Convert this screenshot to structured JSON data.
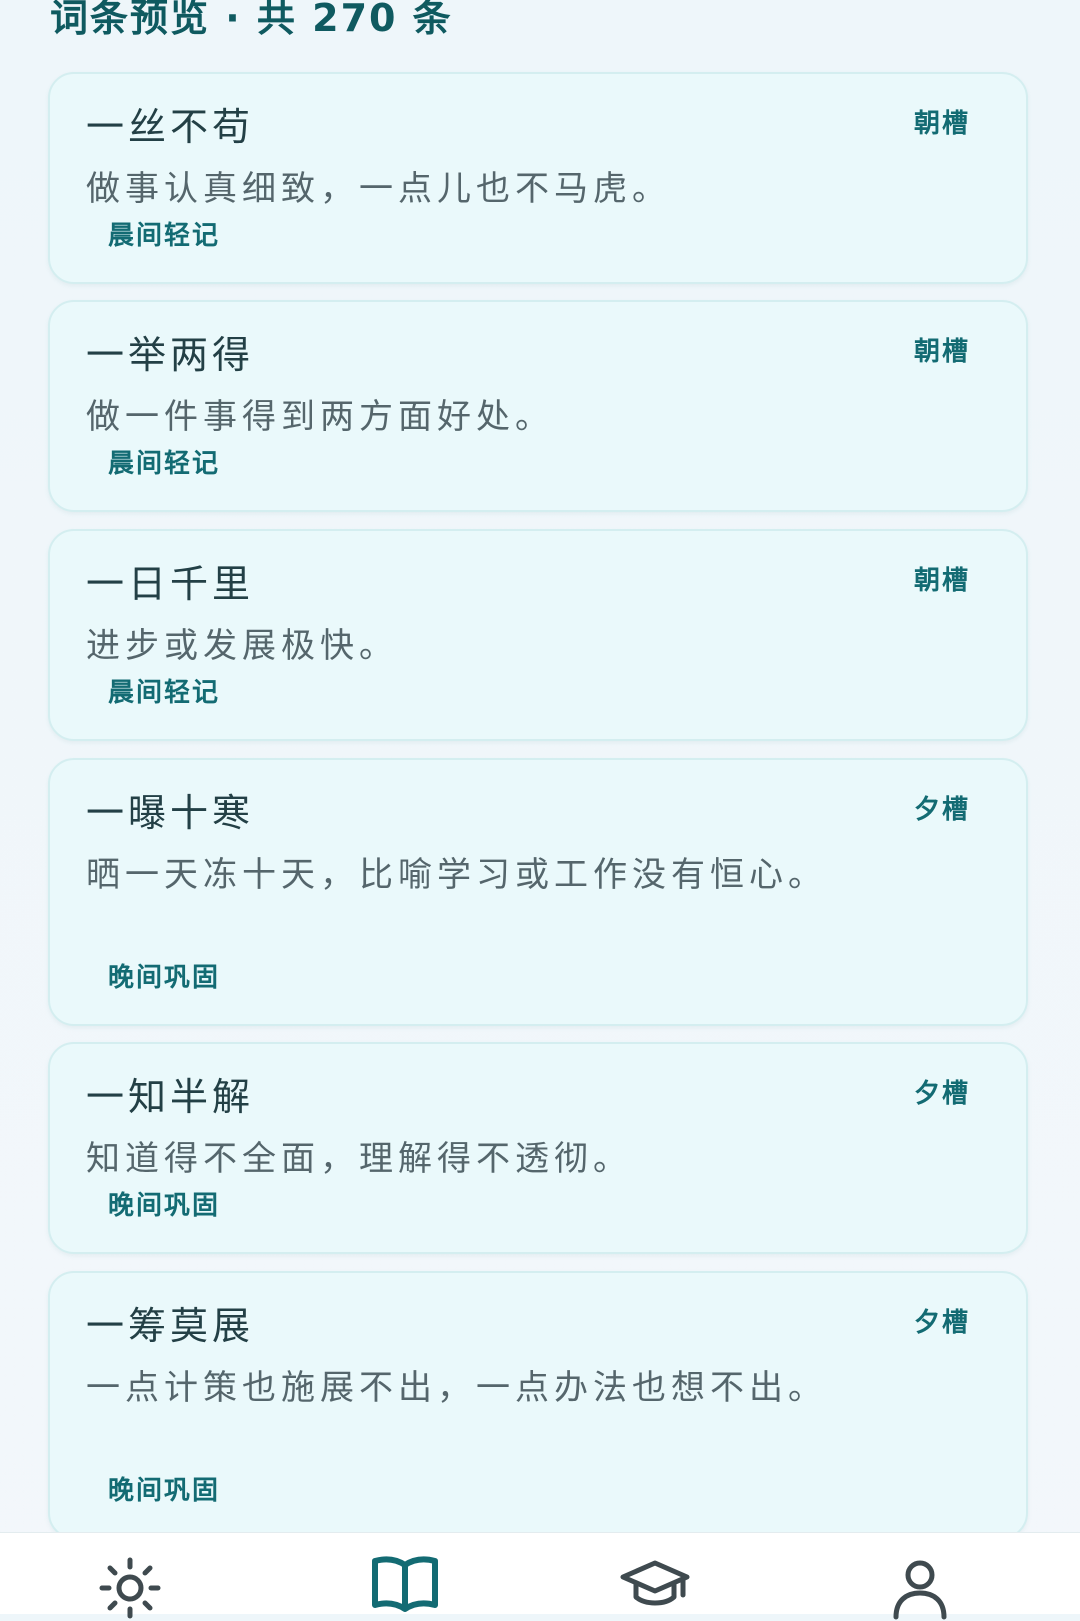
{
  "header": {
    "title": "词条预览 · 共 270 条"
  },
  "entries": [
    {
      "word": "一丝不苟",
      "slot": "朝槽",
      "meaning": "做事认真细致，一点儿也不马虎。",
      "session": "晨间轻记"
    },
    {
      "word": "一举两得",
      "slot": "朝槽",
      "meaning": "做一件事得到两方面好处。",
      "session": "晨间轻记"
    },
    {
      "word": "一日千里",
      "slot": "朝槽",
      "meaning": "进步或发展极快。",
      "session": "晨间轻记"
    },
    {
      "word": "一曝十寒",
      "slot": "夕槽",
      "meaning": "晒一天冻十天，比喻学习或工作没有恒心。",
      "session": "晚间巩固"
    },
    {
      "word": "一知半解",
      "slot": "夕槽",
      "meaning": "知道得不全面，理解得不透彻。",
      "session": "晚间巩固"
    },
    {
      "word": "一筹莫展",
      "slot": "夕槽",
      "meaning": "一点计策也施展不出，一点办法也想不出。",
      "session": "晚间巩固"
    }
  ],
  "tabs": [
    {
      "icon": "sun-icon",
      "active": false
    },
    {
      "icon": "book-icon",
      "active": true
    },
    {
      "icon": "graduation-cap-icon",
      "active": false
    },
    {
      "icon": "user-icon",
      "active": false
    }
  ],
  "colors": {
    "accent": "#136b73",
    "card_background": "#eaf9fb",
    "icon_inactive": "#3f4a4f"
  }
}
